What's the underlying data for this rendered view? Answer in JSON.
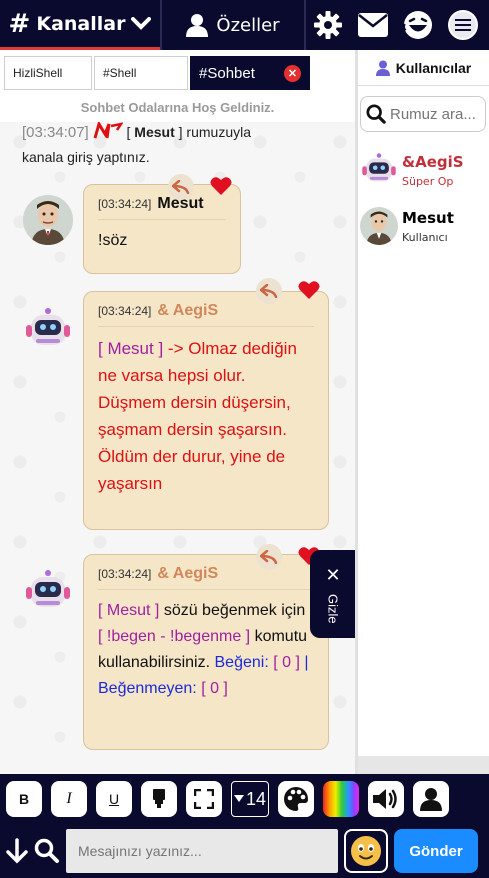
{
  "nav": {
    "channels_label": "Kanallar",
    "private_label": "Özeller",
    "icons": [
      "gear-icon",
      "envelope-icon",
      "laughing-face-icon",
      "hamburger-menu-icon"
    ]
  },
  "tabs": [
    {
      "label": "HizliShell"
    },
    {
      "label": "#Shell"
    },
    {
      "label": "#Sohbet",
      "active": true
    }
  ],
  "welcome_text": "Sohbet Odalarına Hoş Geldiniz.",
  "system_message": {
    "timestamp": "[03:34:07]",
    "bracket_open": "[",
    "nick": "Mesut",
    "bracket_close": "]",
    "text_after": "rumuzuyla",
    "line2": "kanala giriş yaptınız."
  },
  "messages": [
    {
      "timestamp": "[03:34:24]",
      "nick": "Mesut",
      "text": "!söz"
    },
    {
      "timestamp": "[03:34:24]",
      "nick": "& AegiS",
      "mention": "[ Mesut ]",
      "text": "-> Olmaz dediğin ne varsa hepsi olur. Düşmem dersin düşersin, şaşmam dersin şaşarsın. Öldüm der durur, yine de yaşarsın"
    },
    {
      "timestamp": "[03:34:24]",
      "nick": "& AegiS",
      "mention": "[ Mesut ]",
      "text1": "sözü beğenmek için",
      "cmd": "[ !begen - !begenme ]",
      "text2": "komutu kullanabilirsiniz.",
      "likes_label": "Beğeni:",
      "likes_value": "[ 0 ]",
      "sep": "|",
      "dislikes_label": "Beğenmeyen:",
      "dislikes_value": "[ 0 ]"
    }
  ],
  "hide_tab": {
    "close": "✕",
    "label": "Gizle"
  },
  "users_panel": {
    "title": "Kullanıcılar",
    "search_placeholder": "Rumuz ara...",
    "users": [
      {
        "name": "&AegiS",
        "role": "Süper Op"
      },
      {
        "name": "Mesut",
        "role": "Kullanıcı"
      }
    ]
  },
  "toolbar": {
    "bold": "B",
    "italic": "I",
    "underline": "U",
    "font_size": "14"
  },
  "input": {
    "placeholder": "Mesajınızı yazınız...",
    "send_label": "Gönder"
  },
  "colors": {
    "nav_bg": "#0a0a2e",
    "accent_red": "#e23a3a",
    "bubble_bg": "#f5e6c8",
    "send_blue": "#1a8cff",
    "op_nick": "#d0885a"
  }
}
